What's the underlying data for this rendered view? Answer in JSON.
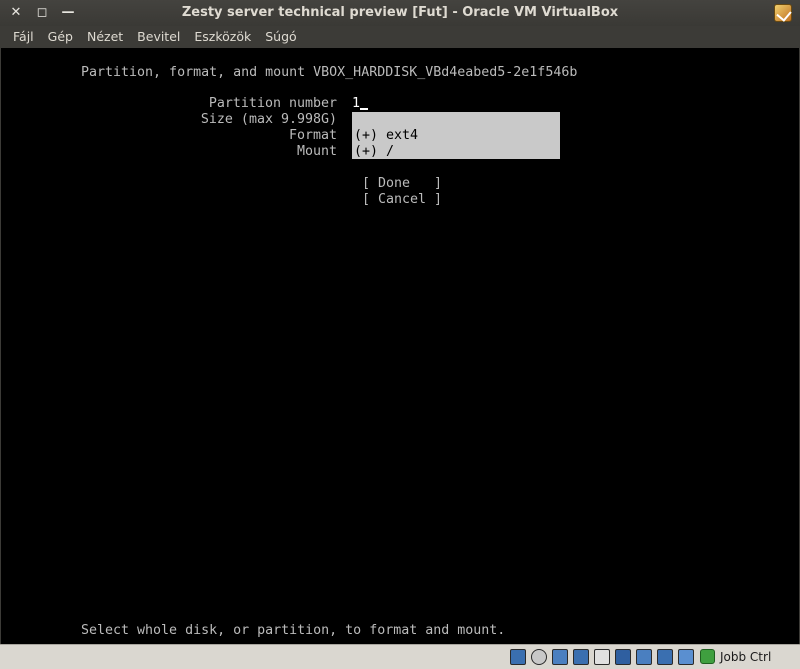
{
  "window": {
    "title": "Zesty server technical preview [Fut] - Oracle VM VirtualBox",
    "close_glyph": "✕",
    "maximize_glyph": "◻",
    "minimize_glyph": "—"
  },
  "menu": {
    "items": [
      "Fájl",
      "Gép",
      "Nézet",
      "Bevitel",
      "Eszközök",
      "Súgó"
    ]
  },
  "console": {
    "heading": "Partition, format, and mount VBOX_HARDDISK_VBd4eabed5-2e1f546b",
    "fields": {
      "partition_number_label": "Partition number",
      "partition_number_value": "1",
      "size_label": "Size (max 9.998G)",
      "format_label": "Format",
      "mount_label": "Mount"
    },
    "dropdown": {
      "format_option": "(+) ext4",
      "mount_option": "(+) /"
    },
    "buttons": {
      "done": "[ Done   ]",
      "cancel": "[ Cancel ]"
    },
    "footer": "Select whole disk, or partition, to format and mount."
  },
  "statusbar": {
    "icons": [
      "hard-disk-icon",
      "optical-drive-icon",
      "network-icon",
      "usb-icon",
      "shared-folder-icon",
      "display-icon",
      "video-capture-icon",
      "virtualization-icon",
      "mouse-integration-icon"
    ],
    "host_key": "Jobb Ctrl"
  },
  "colors": {
    "console_bg": "#000000",
    "console_fg": "#bbbbbb",
    "dropdown_bg": "#c9c9c9",
    "chrome_bg": "#3c3b37",
    "statusbar_bg": "#dad7d0"
  }
}
